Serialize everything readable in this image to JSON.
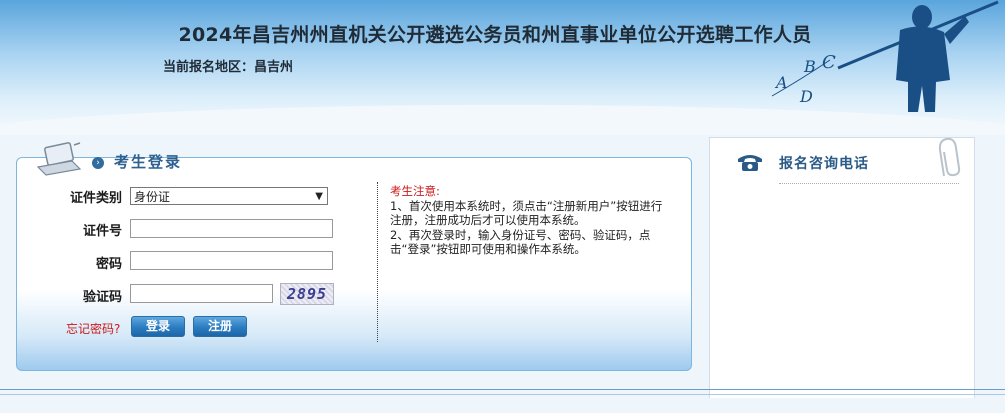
{
  "header": {
    "title": "2024年昌吉州州直机关公开遴选公务员和州直事业单位公开选聘工作人员",
    "region_label": "当前报名地区：昌吉州",
    "figure_letters": [
      "A",
      "B",
      "C",
      "D"
    ]
  },
  "login": {
    "title": "考生登录",
    "fields": {
      "id_type_label": "证件类别",
      "id_type_value": "身份证",
      "id_number_label": "证件号",
      "password_label": "密码",
      "captcha_label": "验证码",
      "captcha_text": "2895"
    },
    "forgot_password": "忘记密码?",
    "login_button": "登录",
    "register_button": "注册",
    "notice": {
      "title": "考生注意:",
      "item1": "1、首次使用本系统时，须点击“注册新用户”按钮进行注册，注册成功后才可以使用本系统。",
      "item2": "2、再次登录时，输入身份证号、密码、验证码，点击“登录”按钮即可使用和操作本系统。"
    }
  },
  "consult": {
    "title": "报名咨询电话"
  },
  "colors": {
    "accent": "#2e6090",
    "notice_red": "#cc1a1a",
    "button_blue": "#2b7cc0"
  },
  "icons": [
    "laptop-icon",
    "bullet-icon",
    "phone-icon",
    "paperclip-icon",
    "chevron-down-icon"
  ]
}
